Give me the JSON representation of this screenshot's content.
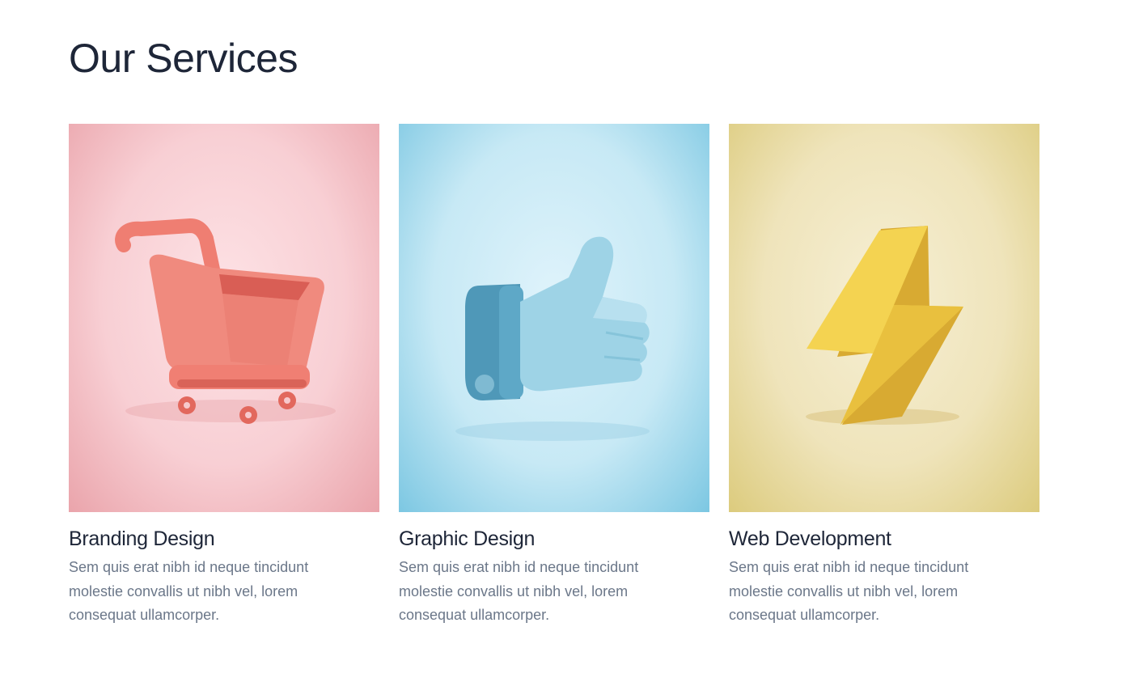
{
  "section": {
    "title": "Our Services"
  },
  "services": [
    {
      "title": "Branding Design",
      "description": "Sem quis erat nibh id neque tincidunt molestie convallis ut nibh vel, lorem consequat ullamcorper.",
      "icon": "shopping-cart-icon",
      "color": "#f8cfd4"
    },
    {
      "title": "Graphic Design",
      "description": "Sem quis erat nibh id neque tincidunt molestie convallis ut nibh vel, lorem consequat ullamcorper.",
      "icon": "thumbs-up-icon",
      "color": "#c7e9f5"
    },
    {
      "title": "Web Development",
      "description": "Sem quis erat nibh id neque tincidunt molestie convallis ut nibh vel, lorem consequat ullamcorper.",
      "icon": "lightning-bolt-icon",
      "color": "#efe4bb"
    }
  ]
}
